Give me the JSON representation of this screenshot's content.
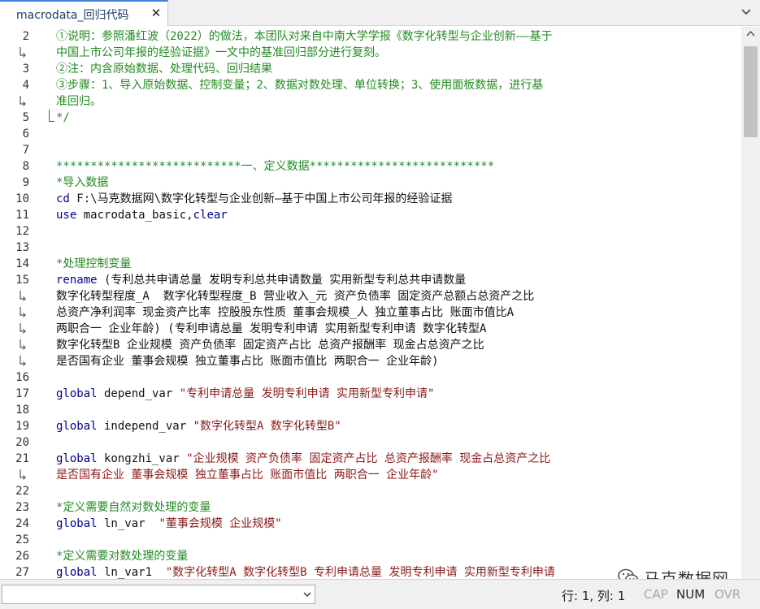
{
  "tab": {
    "title": "macrodata_回归代码",
    "close": "✕"
  },
  "status": {
    "position": "行: 1, 列: 1",
    "cap": "CAP",
    "num": "NUM",
    "ovr": "OVR"
  },
  "watermark": {
    "text": "马克数据网"
  },
  "lines": [
    {
      "n": "2",
      "segs": [
        {
          "t": "①说明：参照潘红波（2022）的做法，本团队对来自中南大学学报《数字化转型与企业创新——基于",
          "c": "cm"
        }
      ]
    },
    {
      "n": "",
      "segs": [
        {
          "t": "中国上市公司年报的经验证据》一文中的基准回归部分进行复刻。",
          "c": "cm"
        }
      ]
    },
    {
      "n": "3",
      "segs": [
        {
          "t": "②注：内含原始数据、处理代码、回归结果",
          "c": "cm"
        }
      ]
    },
    {
      "n": "4",
      "segs": [
        {
          "t": "③步骤：1、导入原始数据、控制变量；2、数据对数处理、单位转换；3、使用面板数据，进行基",
          "c": "cm"
        }
      ]
    },
    {
      "n": "",
      "segs": [
        {
          "t": "准回归。",
          "c": "cm"
        }
      ]
    },
    {
      "n": "5",
      "segs": [
        {
          "t": "*/",
          "c": "cm"
        }
      ]
    },
    {
      "n": "6",
      "segs": []
    },
    {
      "n": "7",
      "segs": []
    },
    {
      "n": "8",
      "segs": [
        {
          "t": "***************************一、定义数据***************************",
          "c": "cm"
        }
      ]
    },
    {
      "n": "9",
      "segs": [
        {
          "t": "*导入数据",
          "c": "cm"
        }
      ]
    },
    {
      "n": "10",
      "segs": [
        {
          "t": "cd",
          "c": "kw"
        },
        {
          "t": " F:\\马克数据网\\数字化转型与企业创新—基于中国上市公司年报的经验证据",
          "c": ""
        }
      ]
    },
    {
      "n": "11",
      "segs": [
        {
          "t": "use",
          "c": "kw"
        },
        {
          "t": " macrodata_basic,",
          "c": ""
        },
        {
          "t": "clear",
          "c": "kw"
        }
      ]
    },
    {
      "n": "12",
      "segs": []
    },
    {
      "n": "13",
      "segs": []
    },
    {
      "n": "14",
      "segs": [
        {
          "t": "*处理控制变量",
          "c": "cm"
        }
      ]
    },
    {
      "n": "15",
      "segs": [
        {
          "t": "rename",
          "c": "kw"
        },
        {
          "t": " (专利总共申请总量 发明专利总共申请数量 实用新型专利总共申请数量",
          "c": ""
        }
      ]
    },
    {
      "n": "",
      "segs": [
        {
          "t": "数字化转型程度_A  数字化转型程度_B 营业收入_元 资产负债率 固定资产总额占总资产之比",
          "c": ""
        }
      ]
    },
    {
      "n": "",
      "segs": [
        {
          "t": "总资产净利润率 现金资产比率 控股股东性质 董事会规模_人 独立董事占比 账面市值比A",
          "c": ""
        }
      ]
    },
    {
      "n": "",
      "segs": [
        {
          "t": "两职合一 企业年龄) (专利申请总量 发明专利申请 实用新型专利申请 数字化转型A",
          "c": ""
        }
      ]
    },
    {
      "n": "",
      "segs": [
        {
          "t": "数字化转型B 企业规模 资产负债率 固定资产占比 总资产报酬率 现金占总资产之比",
          "c": ""
        }
      ]
    },
    {
      "n": "",
      "segs": [
        {
          "t": "是否国有企业 董事会规模 独立董事占比 账面市值比 两职合一 企业年龄)",
          "c": ""
        }
      ]
    },
    {
      "n": "16",
      "segs": []
    },
    {
      "n": "17",
      "segs": [
        {
          "t": "global",
          "c": "kw"
        },
        {
          "t": " depend_var ",
          "c": ""
        },
        {
          "t": "\"专利申请总量 发明专利申请 实用新型专利申请\"",
          "c": "st"
        }
      ]
    },
    {
      "n": "18",
      "segs": []
    },
    {
      "n": "19",
      "segs": [
        {
          "t": "global",
          "c": "kw"
        },
        {
          "t": " independ_var ",
          "c": ""
        },
        {
          "t": "\"数字化转型A 数字化转型B\"",
          "c": "st"
        }
      ]
    },
    {
      "n": "20",
      "segs": []
    },
    {
      "n": "21",
      "segs": [
        {
          "t": "global",
          "c": "kw"
        },
        {
          "t": " kongzhi_var ",
          "c": ""
        },
        {
          "t": "\"企业规模 资产负债率 固定资产占比 总资产报酬率 现金占总资产之比",
          "c": "st"
        }
      ]
    },
    {
      "n": "",
      "segs": [
        {
          "t": "是否国有企业 董事会规模 独立董事占比 账面市值比 两职合一 企业年龄\"",
          "c": "st"
        }
      ]
    },
    {
      "n": "22",
      "segs": []
    },
    {
      "n": "23",
      "segs": [
        {
          "t": "*定义需要自然对数处理的变量",
          "c": "cm"
        }
      ]
    },
    {
      "n": "24",
      "segs": [
        {
          "t": "global",
          "c": "kw"
        },
        {
          "t": " ln_var  ",
          "c": ""
        },
        {
          "t": "\"董事会规模 企业规模\"",
          "c": "st"
        }
      ]
    },
    {
      "n": "25",
      "segs": []
    },
    {
      "n": "26",
      "segs": [
        {
          "t": "*定义需要对数处理的变量",
          "c": "cm"
        }
      ]
    },
    {
      "n": "27",
      "segs": [
        {
          "t": "global",
          "c": "kw"
        },
        {
          "t": " ln_var1  ",
          "c": ""
        },
        {
          "t": "\"数字化转型A 数字化转型B 专利申请总量 发明专利申请 实用新型专利申请",
          "c": "st"
        }
      ]
    }
  ]
}
